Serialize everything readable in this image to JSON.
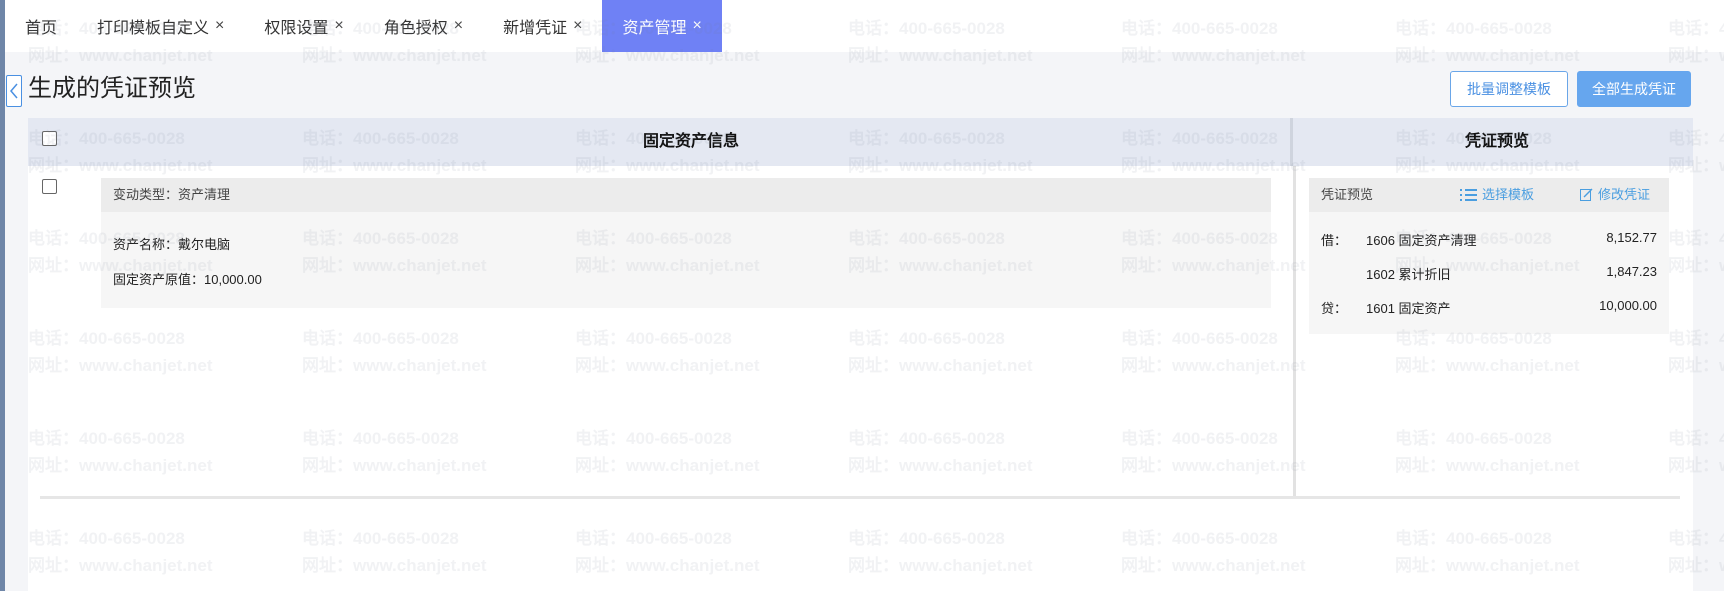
{
  "tabs": [
    {
      "label": "首页",
      "closable": false,
      "active": false
    },
    {
      "label": "打印模板自定义",
      "closable": true,
      "active": false
    },
    {
      "label": "权限设置",
      "closable": true,
      "active": false
    },
    {
      "label": "角色授权",
      "closable": true,
      "active": false
    },
    {
      "label": "新增凭证",
      "closable": true,
      "active": false
    },
    {
      "label": "资产管理",
      "closable": true,
      "active": true
    }
  ],
  "header": {
    "title": "生成的凭证预览",
    "batch_adjust_label": "批量调整模板",
    "generate_all_label": "全部生成凭证"
  },
  "table": {
    "col_asset_info": "固定资产信息",
    "col_voucher_preview": "凭证预览"
  },
  "asset": {
    "change_type": "变动类型：资产清理",
    "name_line": "资产名称：戴尔电脑",
    "value_line": "固定资产原值：10,000.00"
  },
  "voucher": {
    "head_label": "凭证预览",
    "select_template_label": "选择模板",
    "edit_voucher_label": "修改凭证",
    "entries": [
      {
        "dir": "借：",
        "account": "1606 固定资产清理",
        "amount": "8,152.77"
      },
      {
        "dir": "",
        "account": "1602 累计折旧",
        "amount": "1,847.23"
      },
      {
        "dir": "贷：",
        "account": "1601 固定资产",
        "amount": "10,000.00"
      }
    ]
  },
  "watermark": {
    "phone": "电话：400-665-0028",
    "site": "网址：www.chanjet.net"
  },
  "colors": {
    "active_tab": "#6f81f5",
    "primary_button": "#66a6ee",
    "link": "#4a9ee0",
    "table_header": "#e4e8f2"
  }
}
